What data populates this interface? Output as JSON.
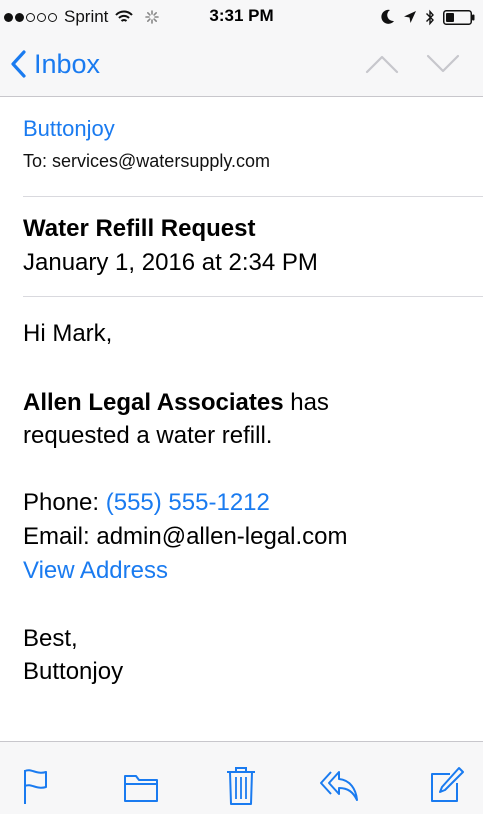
{
  "status_bar": {
    "carrier": "Sprint",
    "time": "3:31 PM",
    "signal_bars_filled": 2,
    "signal_bars_total": 5
  },
  "nav": {
    "back_label": "Inbox",
    "accent_color": "#1a7bf0"
  },
  "message": {
    "sender": "Buttonjoy",
    "to_line": "To: services@watersupply.com",
    "subject": "Water Refill Request",
    "date": "January 1, 2016 at 2:34 PM",
    "greeting": "Hi Mark,",
    "company": "Allen Legal Associates",
    "request_tail": " has",
    "request_line2": "requested a water refill.",
    "phone_label": "Phone: ",
    "phone_value": "(555) 555-1212",
    "email_line": "Email: admin@allen-legal.com",
    "view_address": "View Address",
    "signoff": "Best,",
    "signature": "Buttonjoy"
  },
  "toolbar": {
    "icons": [
      "flag-icon",
      "folder-icon",
      "trash-icon",
      "reply-icon",
      "compose-icon"
    ]
  }
}
